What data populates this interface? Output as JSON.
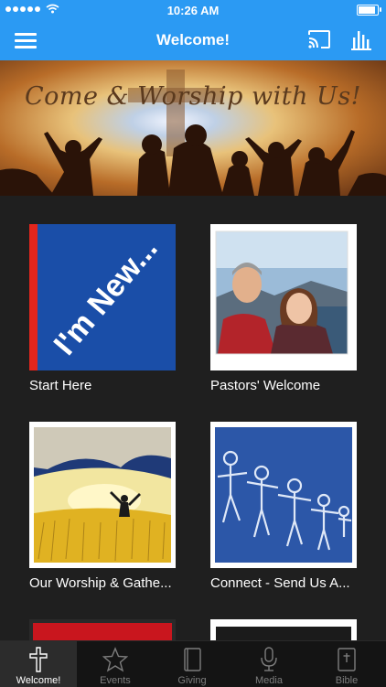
{
  "status_bar": {
    "time": "10:26 AM"
  },
  "header": {
    "title": "Welcome!"
  },
  "banner": {
    "text": "Come & Worship with Us!"
  },
  "tiles": [
    {
      "label": "Start Here",
      "image_text": "I'm New..."
    },
    {
      "label": "Pastors' Welcome"
    },
    {
      "label": "Our Worship & Gathe..."
    },
    {
      "label": "Connect - Send Us A..."
    }
  ],
  "tabs": [
    {
      "label": "Welcome!",
      "icon": "cross-icon",
      "active": true
    },
    {
      "label": "Events",
      "icon": "star-icon",
      "active": false
    },
    {
      "label": "Giving",
      "icon": "book-icon",
      "active": false
    },
    {
      "label": "Media",
      "icon": "microphone-icon",
      "active": false
    },
    {
      "label": "Bible",
      "icon": "bible-icon",
      "active": false
    }
  ],
  "colors": {
    "nav_blue": "#2b9af3",
    "background": "#1f1f1f",
    "tabbar": "#141414"
  }
}
